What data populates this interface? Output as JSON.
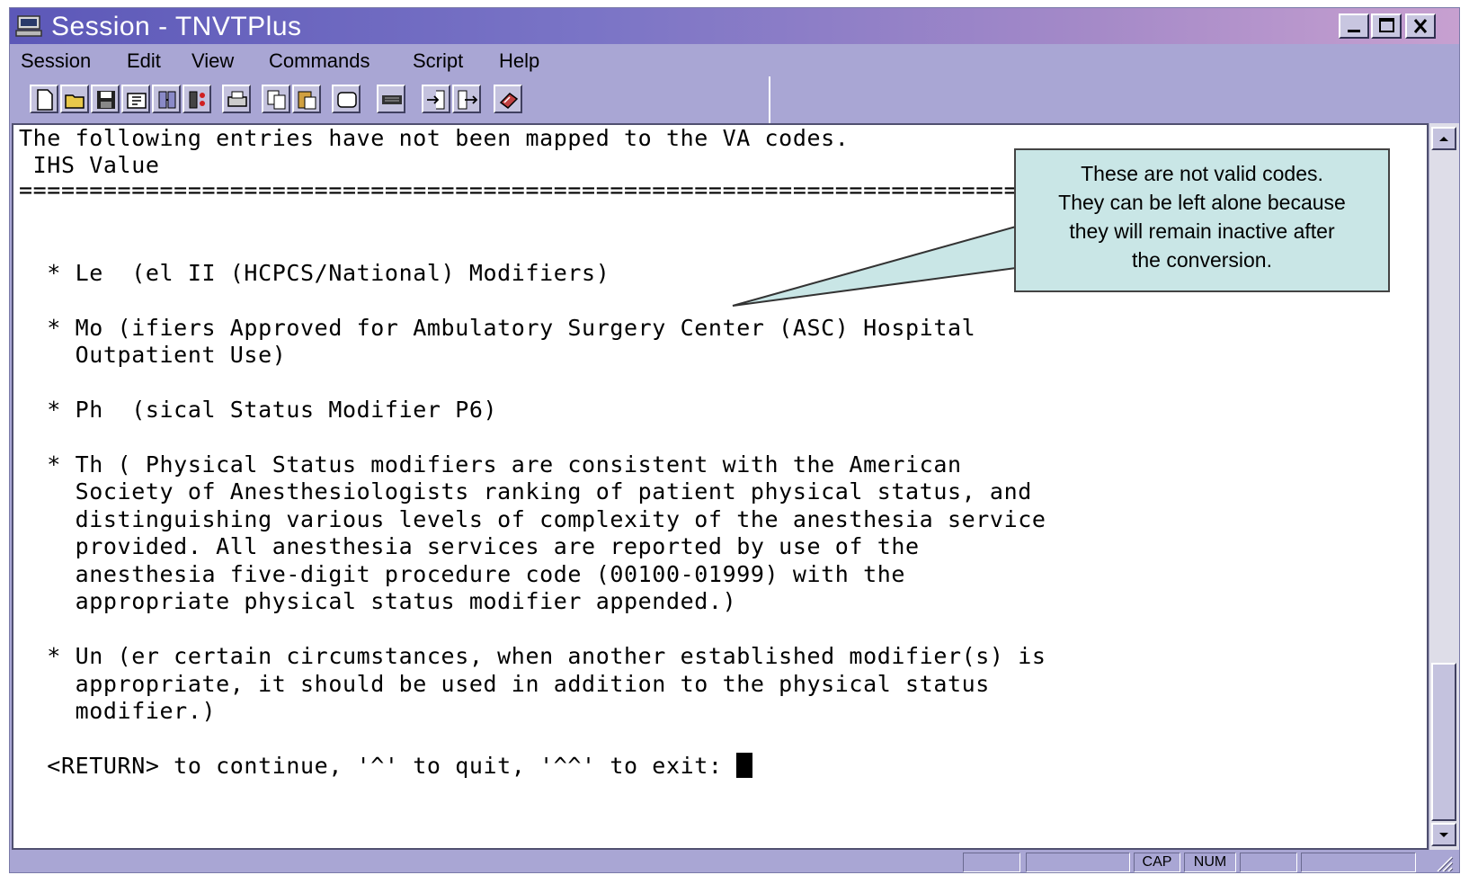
{
  "window": {
    "title": "Session - TNVTPlus",
    "controls": [
      "minimize",
      "maximize",
      "close"
    ]
  },
  "menu": [
    "Session",
    "Edit",
    "View",
    "Commands",
    "Script",
    "Help"
  ],
  "toolbar_icons": [
    "new-session-icon",
    "open-icon",
    "save-icon",
    "properties-icon",
    "connect-icon",
    "disconnect-icon",
    "print-icon",
    "copy-icon",
    "paste-icon",
    "display-icon",
    "keyboard-icon",
    "receive-file-icon",
    "send-file-icon",
    "macro-icon"
  ],
  "terminal": {
    "lines": [
      "The following entries have not been mapped to the VA codes.",
      " IHS Value",
      "================================================================================================",
      "",
      "",
      "  * Le  (el II (HCPCS/National) Modifiers)",
      "",
      "  * Mo (ifiers Approved for Ambulatory Surgery Center (ASC) Hospital",
      "    Outpatient Use)",
      "",
      "  * Ph  (sical Status Modifier P6)",
      "",
      "  * Th ( Physical Status modifiers are consistent with the American",
      "    Society of Anesthesiologists ranking of patient physical status, and",
      "    distinguishing various levels of complexity of the anesthesia service",
      "    provided. All anesthesia services are reported by use of the",
      "    anesthesia five-digit procedure code (00100-01999) with the",
      "    appropriate physical status modifier appended.)",
      "",
      "  * Un (er certain circumstances, when another established modifier(s) is",
      "    appropriate, it should be used in addition to the physical status",
      "    modifier.)",
      ""
    ],
    "prompt": "  <RETURN> to continue, '^' to quit, '^^' to exit: "
  },
  "callout": {
    "lines": [
      "These are not valid codes.",
      "They can be left alone because",
      "they will remain inactive after",
      "the conversion."
    ]
  },
  "status": {
    "cap": "CAP",
    "num": "NUM"
  },
  "colors": {
    "chrome": "#a9a6d4",
    "titlebar_start": "#5c58b8",
    "titlebar_end": "#c7a0d0",
    "callout_bg": "#c9e6e6"
  }
}
